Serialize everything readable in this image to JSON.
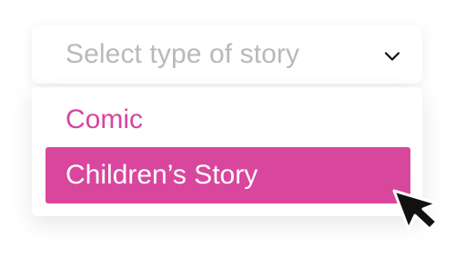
{
  "select": {
    "placeholder": "Select type of story",
    "icon": "chevron-down-icon"
  },
  "dropdown": {
    "options": [
      {
        "label": "Comic",
        "selected": false
      },
      {
        "label": "Children’s Story",
        "selected": true
      }
    ]
  },
  "colors": {
    "accent": "#d8479d",
    "placeholder": "#b9b9b9",
    "option_text": "#d8459e",
    "selected_text": "#ffffff",
    "background": "#ffffff"
  },
  "cursor": {
    "icon": "mouse-pointer-icon"
  }
}
